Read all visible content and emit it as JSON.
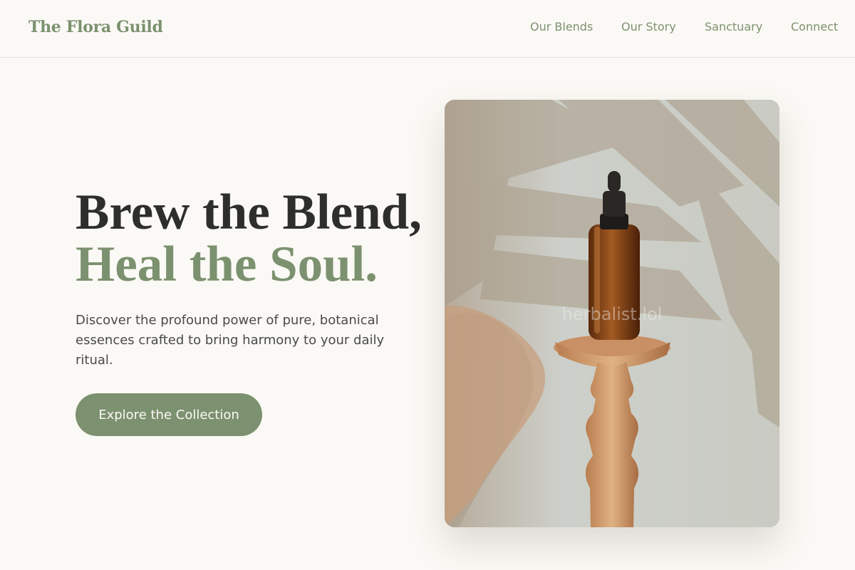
{
  "brand": {
    "name": "The Flora Guild"
  },
  "nav": {
    "items": [
      {
        "label": "Our Blends"
      },
      {
        "label": "Our Story"
      },
      {
        "label": "Sanctuary"
      },
      {
        "label": "Connect"
      }
    ]
  },
  "hero": {
    "title_line1": "Brew the Blend,",
    "title_line2": "Heal the Soul.",
    "description": "Discover the profound power of pure, botanical essences crafted to bring harmony to your daily ritual.",
    "cta_label": "Explore the Collection"
  },
  "image": {
    "subject": "amber-dropper-bottle-on-wooden-pedestal",
    "watermark": "herbalist.lol"
  },
  "colors": {
    "accent": "#7c916f",
    "background": "#fbf9f5",
    "heading": "#2e2e2c",
    "body_text": "#4a4a48"
  }
}
